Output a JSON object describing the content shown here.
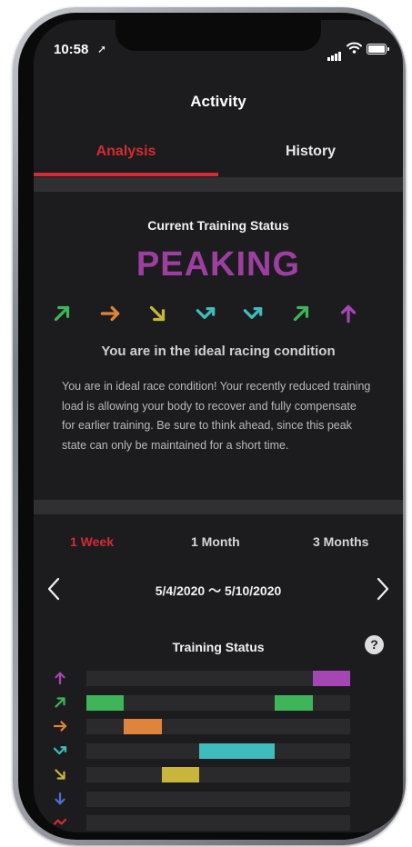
{
  "status_bar": {
    "time": "10:58"
  },
  "nav": {
    "title": "Activity"
  },
  "tabs": [
    {
      "label": "Analysis",
      "active": true
    },
    {
      "label": "History",
      "active": false
    }
  ],
  "current_status": {
    "label": "Current Training Status",
    "value": "PEAKING",
    "value_color": "#9c3fa0",
    "subtitle": "You are in the ideal racing condition",
    "description": "You are in ideal race condition! Your recently reduced training load is allowing your body to recover and fully compensate for earlier training. Be sure to think ahead, since this peak state can only be maintained for a short time."
  },
  "trend_arrows": [
    {
      "icon": "arrow-up-right-icon",
      "color": "#3fb55a"
    },
    {
      "icon": "arrow-right-icon",
      "color": "#e0843b"
    },
    {
      "icon": "arrow-down-right-icon",
      "color": "#c7b63a"
    },
    {
      "icon": "check-arrow-icon",
      "color": "#3fbcbc"
    },
    {
      "icon": "check-arrow-icon",
      "color": "#3fbcbc"
    },
    {
      "icon": "arrow-up-right-icon",
      "color": "#3fb55a"
    },
    {
      "icon": "arrow-up-icon",
      "color": "#a646b5"
    }
  ],
  "range_tabs": [
    {
      "label": "1 Week",
      "active": true
    },
    {
      "label": "1 Month",
      "active": false
    },
    {
      "label": "3 Months",
      "active": false
    }
  ],
  "date_range": "5/4/2020 〜 5/10/2020",
  "chart": {
    "title": "Training Status",
    "days": 7,
    "rows": [
      {
        "status": "peaking",
        "icon": "arrow-up-icon",
        "color": "#a646b5",
        "spans": [
          [
            6,
            7
          ]
        ]
      },
      {
        "status": "productive",
        "icon": "arrow-up-right-icon",
        "color": "#3fb55a",
        "spans": [
          [
            0,
            1
          ],
          [
            5,
            6
          ]
        ]
      },
      {
        "status": "maintaining",
        "icon": "arrow-right-icon",
        "color": "#e0843b",
        "spans": [
          [
            1,
            2
          ]
        ]
      },
      {
        "status": "recovery",
        "icon": "check-arrow-icon",
        "color": "#3fbcbc",
        "spans": [
          [
            3,
            5
          ]
        ]
      },
      {
        "status": "unproductive",
        "icon": "arrow-down-right-icon",
        "color": "#c7b63a",
        "spans": [
          [
            2,
            3
          ]
        ]
      },
      {
        "status": "detraining",
        "icon": "arrow-down-icon",
        "color": "#4a6fd6",
        "spans": []
      },
      {
        "status": "overreaching",
        "icon": "overreaching-icon",
        "color": "#d52b34",
        "spans": []
      }
    ]
  },
  "colors": {
    "accent": "#d52b34",
    "background": "#1c1c1e",
    "separator": "#303033"
  }
}
